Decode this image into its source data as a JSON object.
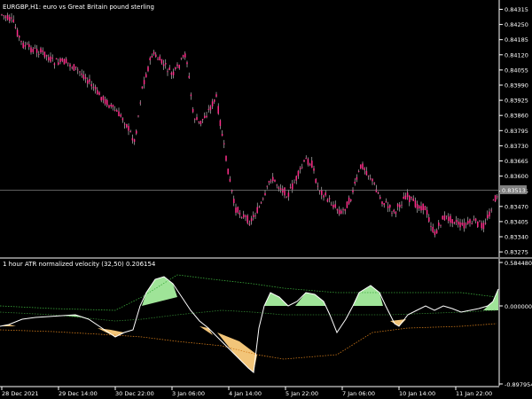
{
  "main_chart": {
    "title": "EURGBP,H1: euro vs Great Britain pound sterling",
    "price_labels": [
      "0.84315",
      "0.84250",
      "0.84185",
      "0.84120",
      "0.84055",
      "0.83990",
      "0.83925",
      "0.83860",
      "0.83795",
      "0.83730",
      "0.83665",
      "0.83600",
      "0.83535",
      "0.83470",
      "0.83405",
      "0.83340",
      "0.83275"
    ],
    "current_price": "0.83513",
    "colors": {
      "candle": "#ff2d8a",
      "candle_wick": "#ffffff",
      "price_line": "#7f7f7f",
      "bg": "#000000"
    }
  },
  "indicator": {
    "title": "1 hour ATR normalized velocity (32,50) 0.206154",
    "axis_labels": {
      "top": "0.584480",
      "zero": "0.000000",
      "bottom": "-0.897954"
    },
    "colors": {
      "fill_pos": "#a8f0a0",
      "fill_neg": "#ffd080",
      "line": "#ffffff",
      "band_upper": "#3aaa3a",
      "band_lower": "#d07a1a",
      "band_mid": "#2f7f2f"
    }
  },
  "time_axis": {
    "labels": [
      "28 Dec 2021",
      "29 Dec 14:00",
      "30 Dec 22:00",
      "3 Jan 06:00",
      "4 Jan 14:00",
      "5 Jan 22:00",
      "7 Jan 06:00",
      "10 Jan 14:00",
      "11 Jan 22:00"
    ]
  }
}
